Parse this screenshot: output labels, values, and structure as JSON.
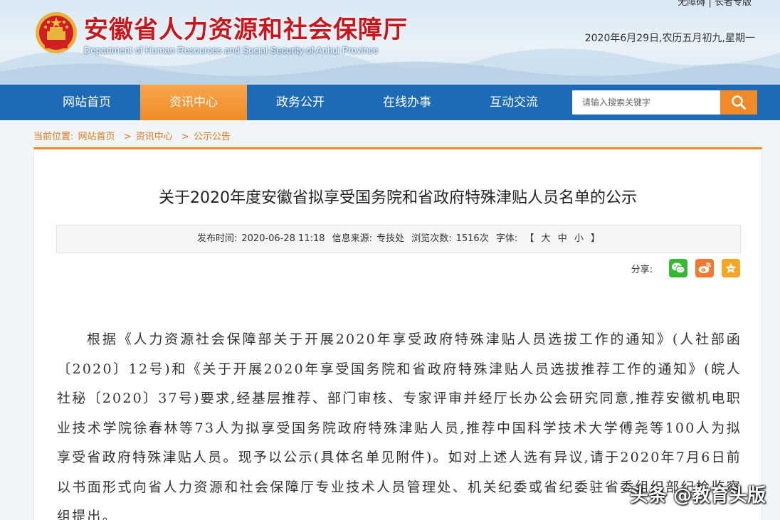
{
  "header": {
    "top_links": "无障碍 | 长者专版",
    "title": "安徽省人力资源和社会保障厅",
    "subtitle": "Department of Human Resources and Social Security of Anhui Province",
    "date": "2020年6月29日,农历五月初九,星期一"
  },
  "nav": {
    "items": [
      {
        "label": "网站首页"
      },
      {
        "label": "资讯中心"
      },
      {
        "label": "政务公开"
      },
      {
        "label": "在线办事"
      },
      {
        "label": "互动交流"
      }
    ],
    "active_index": 1,
    "search": {
      "placeholder": "请输入搜索关键字"
    }
  },
  "breadcrumb": {
    "prefix": "当前位置:",
    "items": [
      "网站首页",
      "资讯中心",
      "公示公告"
    ],
    "separator": ">"
  },
  "article": {
    "title": "关于2020年度安徽省拟享受国务院和省政府特殊津贴人员名单的公示",
    "meta": {
      "publish_label": "发布时间:",
      "publish_time": "2020-06-28 11:18",
      "source_label": "信息来源:",
      "source": "专技处",
      "views_label": "浏览次数:",
      "views": "1516次",
      "font_label": "字体:",
      "bracket_open": "【",
      "bracket_close": "】",
      "font_large": "大",
      "font_medium": "中",
      "font_small": "小"
    },
    "share_label": "分享:",
    "body": "根据《人力资源社会保障部关于开展2020年享受政府特殊津贴人员选拔工作的通知》(人社部函〔2020〕12号)和《关于开展2020年享受国务院和省政府特殊津贴人员选拔推荐工作的通知》(皖人社秘〔2020〕37号)要求,经基层推荐、部门审核、专家评审并经厅长办公会研究同意,推荐安徽机电职业技术学院徐春林等73人为拟享受国务院政府特殊津贴人员,推荐中国科学技术大学傅尧等100人为拟享受省政府特殊津贴人员。现予以公示(具体名单见附件)。如对上述人选有异议,请于2020年7月6日前以书面形式向省人力资源和社会保障厅专业技术人员管理处、机关纪委或省纪委驻省委组织部纪检监察组提出。"
  },
  "watermark": "头条 @教育头版",
  "colors": {
    "brand_red": "#c8161d",
    "nav_blue": "#1d6ab6",
    "accent_orange": "#f08a26",
    "wechat_green": "#35b934",
    "weibo_orange": "#f4792f"
  }
}
